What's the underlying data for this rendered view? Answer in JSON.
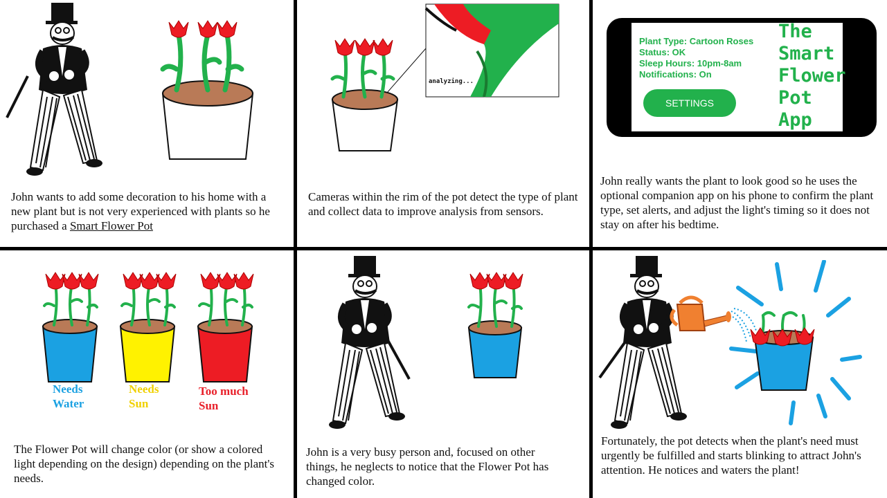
{
  "panels": {
    "p1": {
      "caption_pre": "John wants to add some decoration to his home with a new plant but is not very experienced with plants so he purchased a ",
      "caption_link": "Smart Flower Pot"
    },
    "p2": {
      "caption": "Cameras within the rim of the pot detect the type of plant and collect data to improve analysis from sensors.",
      "zoom_label": "analyzing..."
    },
    "p3": {
      "caption": "John really wants the plant to look good so he uses the optional companion app on his phone to confirm the plant type, set alerts, and adjust the light's timing so it does not stay on after his bedtime.",
      "app": {
        "plant_type": "Plant Type: Cartoon Roses",
        "status": "Status: OK",
        "sleep_hours": "Sleep Hours: 10pm-8am",
        "notifications": "Notifications: On",
        "settings_label": "SETTINGS",
        "title_lines": [
          "The",
          "Smart",
          "Flower",
          "Pot",
          "App"
        ]
      }
    },
    "p4": {
      "caption": "The Flower Pot will change color (or show a colored light depending on the design) depending on the plant's needs.",
      "states": [
        {
          "line1": "Needs",
          "line2": "Water",
          "color": "#1ba1e2"
        },
        {
          "line1": "Needs",
          "line2": "Sun",
          "color": "#f0d000"
        },
        {
          "line1": "Too much",
          "line2": "Sun",
          "color": "#e8202a"
        }
      ]
    },
    "p5": {
      "caption": "John is a very busy person and, focused on other things, he neglects to notice that the Flower Pot has changed color."
    },
    "p6": {
      "caption": "Fortunately, the pot detects when the plant's need must urgently be fulfilled and starts blinking to attract John's attention. He notices and waters the plant!"
    }
  },
  "colors": {
    "blue_pot": "#1ba1e2",
    "yellow_pot": "#fff200",
    "red_pot": "#ed1c24",
    "green": "#22b14c",
    "soil": "#b97a57"
  }
}
